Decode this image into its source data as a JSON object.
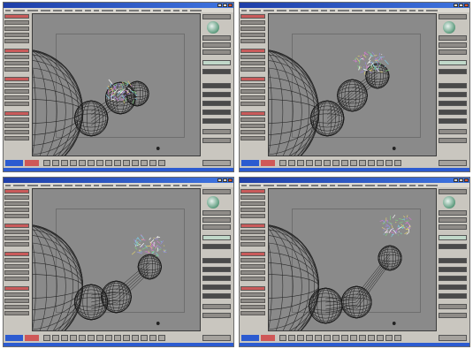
{
  "window_title": "",
  "colors": {
    "title_bar": "#2c5bd0",
    "viewport_bg": "#8a8a8a",
    "panel_bg": "#c9c6bf",
    "active_tool": "#c95a5a",
    "wire": "#1a1a1a",
    "gripper": "#d47ad0"
  },
  "icons": [
    "minimize-icon",
    "maximize-icon",
    "close-icon",
    "navigation-sphere-icon",
    "play-icon"
  ],
  "panels": [
    {
      "id": "top-left",
      "pose": 0
    },
    {
      "id": "top-right",
      "pose": 1
    },
    {
      "id": "bottom-left",
      "pose": 2
    },
    {
      "id": "bottom-right",
      "pose": 3
    }
  ]
}
